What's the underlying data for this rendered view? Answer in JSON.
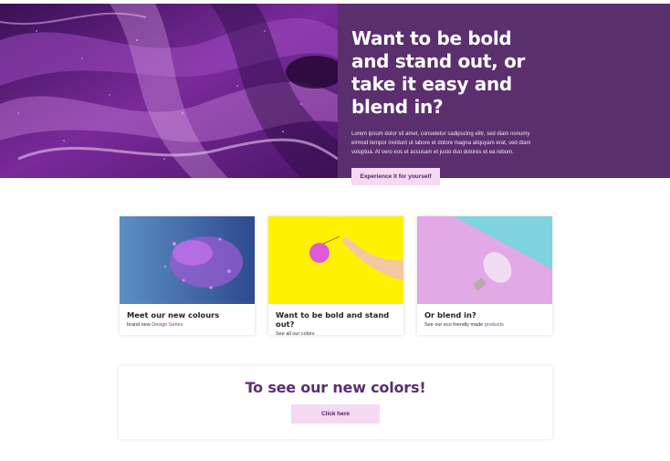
{
  "hero": {
    "image_icon": "purple-marble-image",
    "title": "Want to be bold and stand out, or take it easy and blend in?",
    "text": "Lorem ipsum dolor sit amet, consetetur sadipscing elitr, sed diam nonumy eirmod tempor invidunt ut labore et dolore magna aliquyam erat, sed diam voluptua. At vero eos et accusam et justo duo dolores et ea rebum.",
    "button_label": "Experience it for yourself",
    "panel_color": "#5b2e6e"
  },
  "cards": [
    {
      "image_icon": "purple-powder-image",
      "title": "Meet our new colours",
      "sub_prefix": "brand new ",
      "sub_link": "Design Series",
      "sub_suffix": ""
    },
    {
      "image_icon": "hand-holding-ball-image",
      "title": "Want to be bold and stand out?",
      "sub_prefix": "See all our colors",
      "sub_link": "",
      "sub_suffix": ""
    },
    {
      "image_icon": "lightbulb-image",
      "title": "Or blend in?",
      "sub_prefix": "See our eco friendly made ",
      "sub_link": "products",
      "sub_suffix": ""
    }
  ],
  "cta": {
    "title": "To see our new colors!",
    "button_label": "Click here"
  },
  "colors": {
    "accent": "#5b2e6e",
    "button": "#f6d9f2",
    "link": "#7a3a94"
  }
}
